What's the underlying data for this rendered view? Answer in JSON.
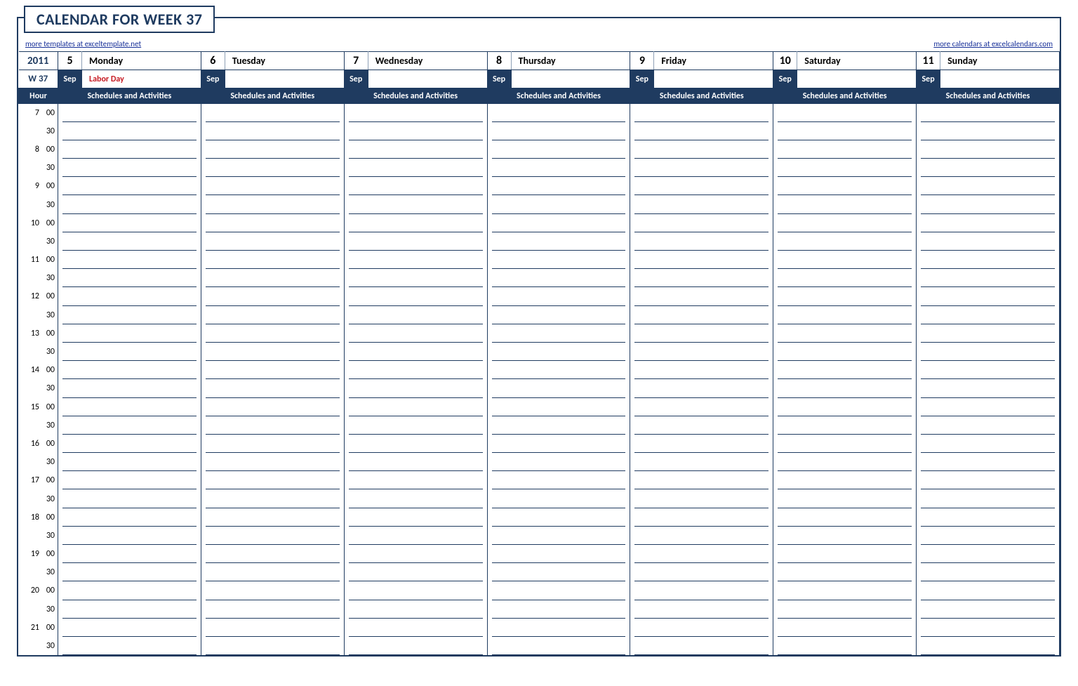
{
  "title": "CALENDAR FOR WEEK 37",
  "links": {
    "left": "more templates at exceltemplate.net",
    "right": "more calendars at excelcalendars.com"
  },
  "header": {
    "year": "2011",
    "week": "W 37",
    "hour_label": "Hour",
    "sched_label": "Schedules and Activities"
  },
  "days": [
    {
      "num": "5",
      "name": "Monday",
      "month": "Sep",
      "note": "Labor Day",
      "holiday": true
    },
    {
      "num": "6",
      "name": "Tuesday",
      "month": "Sep",
      "note": "",
      "holiday": false
    },
    {
      "num": "7",
      "name": "Wednesday",
      "month": "Sep",
      "note": "",
      "holiday": false
    },
    {
      "num": "8",
      "name": "Thursday",
      "month": "Sep",
      "note": "",
      "holiday": false
    },
    {
      "num": "9",
      "name": "Friday",
      "month": "Sep",
      "note": "",
      "holiday": false
    },
    {
      "num": "10",
      "name": "Saturday",
      "month": "Sep",
      "note": "",
      "holiday": false
    },
    {
      "num": "11",
      "name": "Sunday",
      "month": "Sep",
      "note": "",
      "holiday": false
    }
  ],
  "time_slots": [
    {
      "h": "7",
      "m": "00"
    },
    {
      "h": "",
      "m": "30"
    },
    {
      "h": "8",
      "m": "00"
    },
    {
      "h": "",
      "m": "30"
    },
    {
      "h": "9",
      "m": "00"
    },
    {
      "h": "",
      "m": "30"
    },
    {
      "h": "10",
      "m": "00"
    },
    {
      "h": "",
      "m": "30"
    },
    {
      "h": "11",
      "m": "00"
    },
    {
      "h": "",
      "m": "30"
    },
    {
      "h": "12",
      "m": "00"
    },
    {
      "h": "",
      "m": "30"
    },
    {
      "h": "13",
      "m": "00"
    },
    {
      "h": "",
      "m": "30"
    },
    {
      "h": "14",
      "m": "00"
    },
    {
      "h": "",
      "m": "30"
    },
    {
      "h": "15",
      "m": "00"
    },
    {
      "h": "",
      "m": "30"
    },
    {
      "h": "16",
      "m": "00"
    },
    {
      "h": "",
      "m": "30"
    },
    {
      "h": "17",
      "m": "00"
    },
    {
      "h": "",
      "m": "30"
    },
    {
      "h": "18",
      "m": "00"
    },
    {
      "h": "",
      "m": "30"
    },
    {
      "h": "19",
      "m": "00"
    },
    {
      "h": "",
      "m": "30"
    },
    {
      "h": "20",
      "m": "00"
    },
    {
      "h": "",
      "m": "30"
    },
    {
      "h": "21",
      "m": "00"
    },
    {
      "h": "",
      "m": "30"
    }
  ]
}
